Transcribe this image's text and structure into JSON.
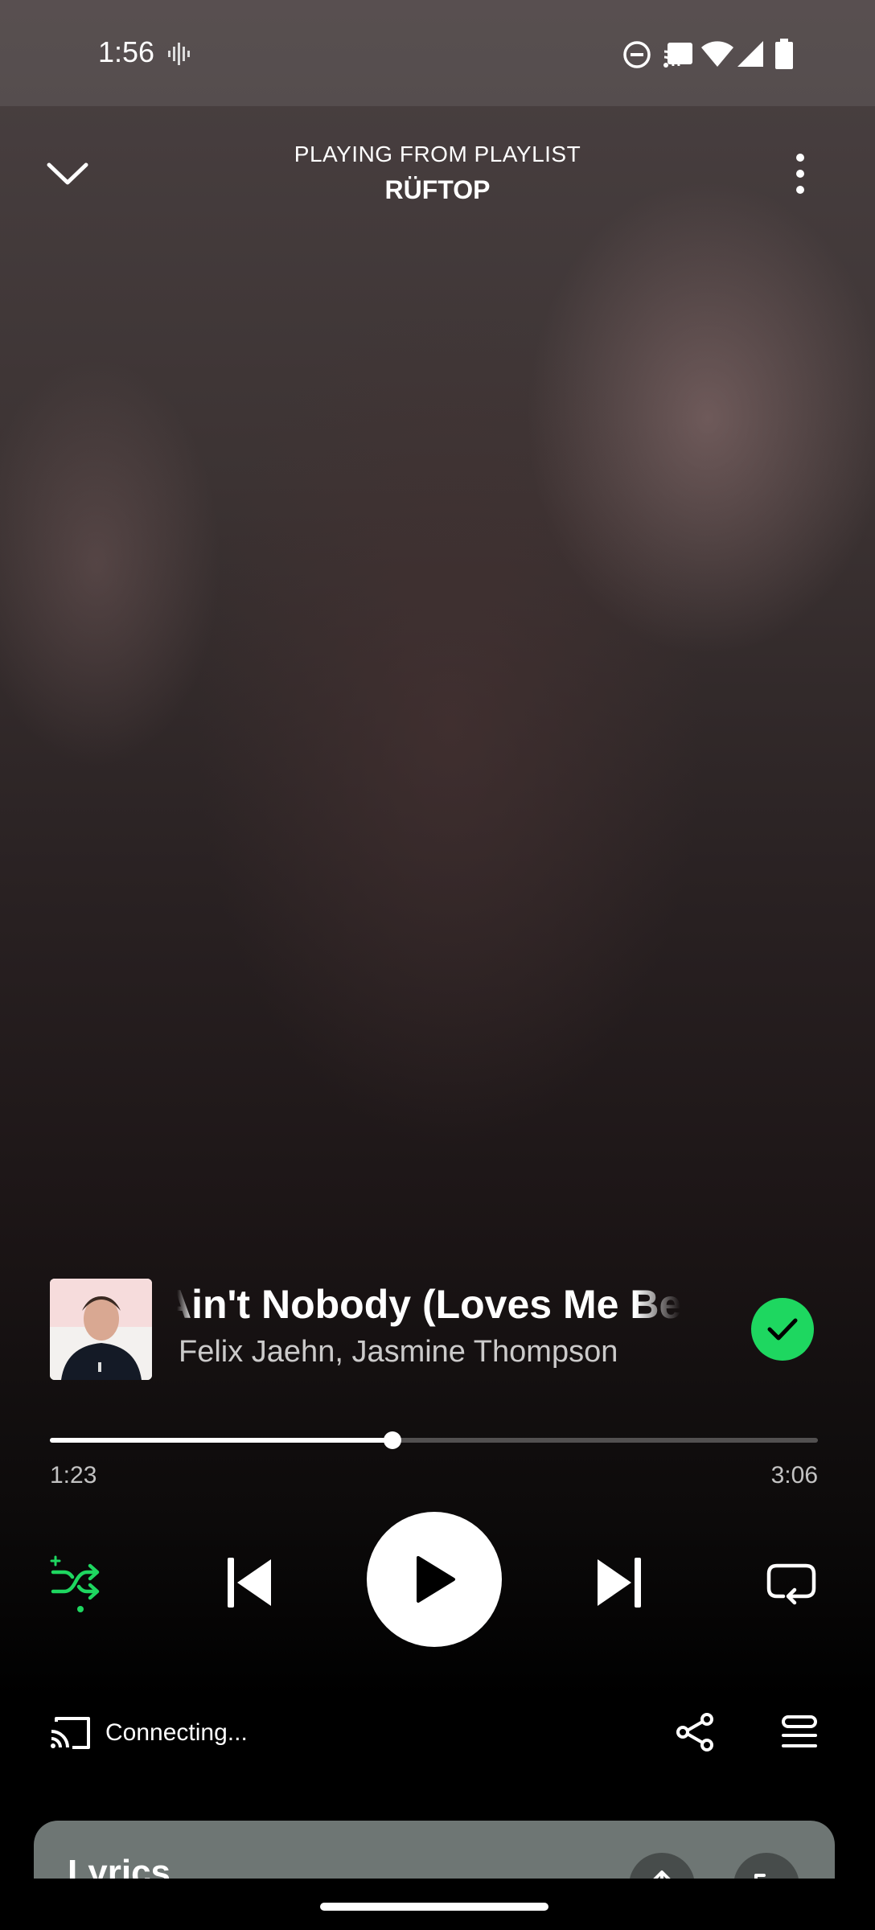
{
  "status_bar": {
    "time": "1:56"
  },
  "header": {
    "context_label": "PLAYING FROM PLAYLIST",
    "playlist_name": "RÜFTOP"
  },
  "track": {
    "title": "Ain't Nobody (Loves Me Better)",
    "artists": "Felix Jaehn, Jasmine Thompson",
    "saved": true
  },
  "progress": {
    "elapsed": "1:23",
    "total": "3:06",
    "fraction": 0.446
  },
  "device": {
    "status": "Connecting..."
  },
  "lyrics": {
    "label": "Lyrics"
  },
  "colors": {
    "accent": "#1ED760"
  }
}
